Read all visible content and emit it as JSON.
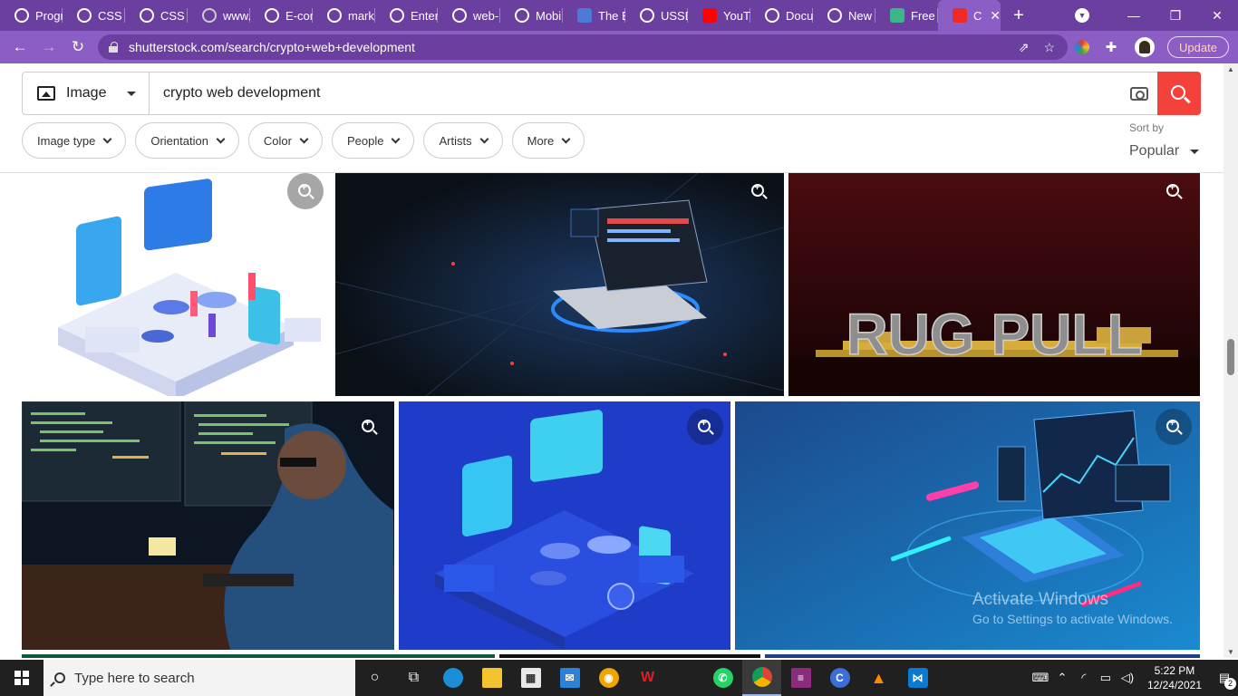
{
  "browser": {
    "tabs": [
      {
        "title": "Progr",
        "icon": "globe-icon",
        "color": "#ffffff"
      },
      {
        "title": "CSS I",
        "icon": "globe-icon",
        "color": "#ffffff"
      },
      {
        "title": "CSS b",
        "icon": "globe-icon",
        "color": "#ffffff"
      },
      {
        "title": "www.",
        "icon": "globe-icon",
        "color": "#cccccc"
      },
      {
        "title": "E-con",
        "icon": "globe-icon",
        "color": "#ffffff"
      },
      {
        "title": "mark",
        "icon": "globe-icon",
        "color": "#ffffff"
      },
      {
        "title": "Enter",
        "icon": "globe-icon",
        "color": "#ffffff"
      },
      {
        "title": "web-",
        "icon": "globe-icon",
        "color": "#ffffff"
      },
      {
        "title": "Mobi",
        "icon": "globe-icon",
        "color": "#ffffff"
      },
      {
        "title": "The B",
        "icon": "dapp-icon",
        "color": "#4b7bd6"
      },
      {
        "title": "USSD",
        "icon": "globe-icon",
        "color": "#ffffff"
      },
      {
        "title": "YouT",
        "icon": "youtube-icon",
        "color": "#ff0000"
      },
      {
        "title": "Docu",
        "icon": "globe-icon",
        "color": "#ffffff"
      },
      {
        "title": "New",
        "icon": "globe-icon",
        "color": "#ffffff"
      },
      {
        "title": "Free",
        "icon": "d-icon",
        "color": "#3bb58a"
      },
      {
        "title": "C",
        "icon": "shutterstock-icon",
        "color": "#ee2b24",
        "active": true
      }
    ],
    "new_tab_label": "+",
    "url": "shutterstock.com/search/crypto+web+development",
    "update_label": "Update"
  },
  "search": {
    "type_label": "Image",
    "query": "crypto web development"
  },
  "filters": [
    "Image type",
    "Orientation",
    "Color",
    "People",
    "Artists",
    "More"
  ],
  "sort": {
    "label": "Sort by",
    "value": "Popular"
  },
  "results": [
    {
      "name": "isometric-crypto-devices-illustration",
      "bg": "#ffffff"
    },
    {
      "name": "glowing-laptop-futuristic",
      "bg": "#0e141b"
    },
    {
      "name": "rug-pull-coins",
      "bg": "#2a0a0a"
    },
    {
      "name": "developer-at-monitors",
      "bg": "#0f1a2c"
    },
    {
      "name": "isometric-blue-devices",
      "bg": "#1f3cc9"
    },
    {
      "name": "isometric-blue-laptop-data",
      "bg": "#1e6fb8"
    }
  ],
  "watermark": {
    "line1": "Activate Windows",
    "line2": "Go to Settings to activate Windows."
  },
  "taskbar": {
    "search_placeholder": "Type here to search",
    "time": "5:22 PM",
    "date": "12/24/2021",
    "notification_count": "2"
  }
}
